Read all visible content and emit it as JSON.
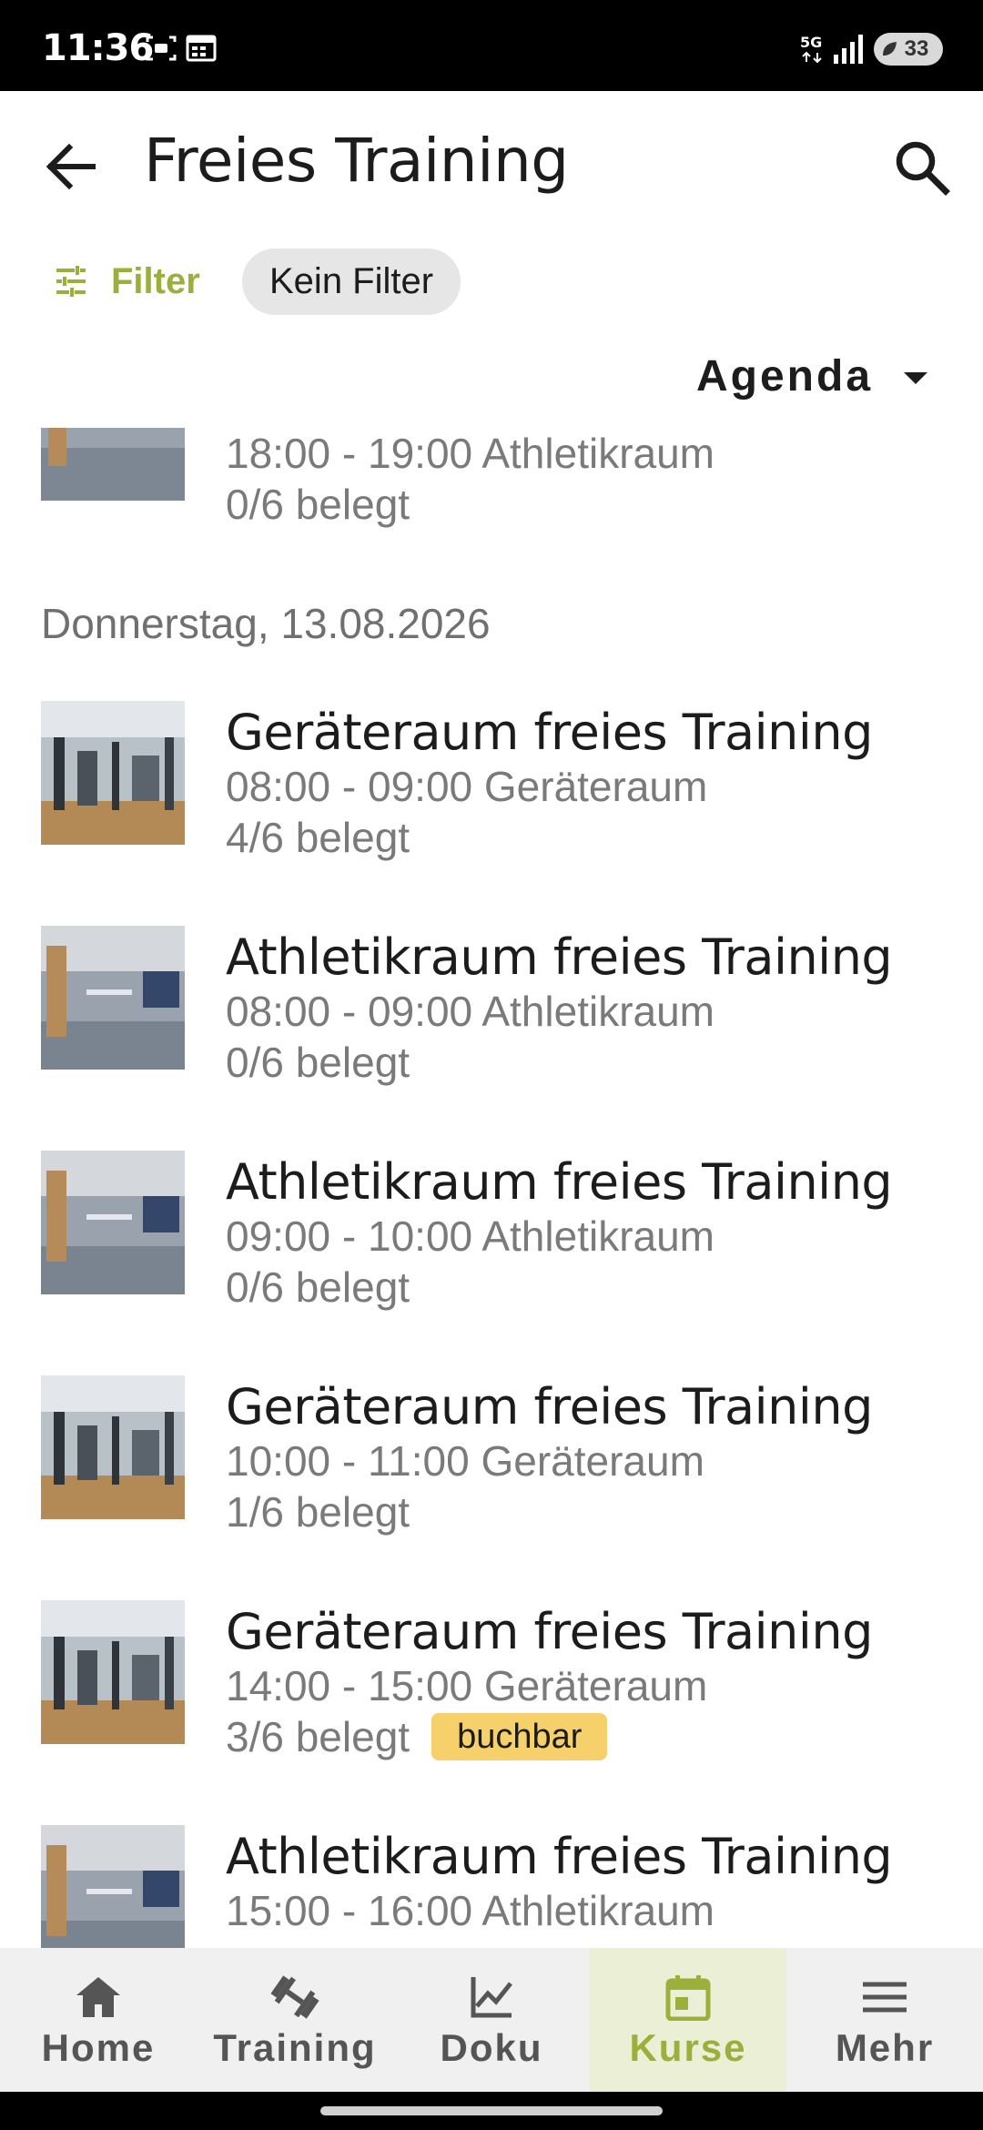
{
  "status_bar": {
    "time": "11:36",
    "network": "5G",
    "battery": "33"
  },
  "app_bar": {
    "title": "Freies Training",
    "back_icon": "arrow-back-icon",
    "search_icon": "search-icon"
  },
  "filter": {
    "label": "Filter",
    "icon": "tune-icon",
    "chip_label": "Kein Filter",
    "accent_color": "#9bb03a"
  },
  "view_mode": {
    "selected": "Agenda"
  },
  "list": {
    "partial_row": {
      "line1": "18:00 - 19:00 Athletikraum",
      "line2": "0/6 belegt",
      "image": "athletikraum"
    },
    "day_header": "Donnerstag, 13.08.2026",
    "rows": [
      {
        "title": "Geräteraum freies Training",
        "line1": "08:00 - 09:00 Geräteraum",
        "line2": "4/6 belegt",
        "badge": "",
        "image": "geraeteraum"
      },
      {
        "title": "Athletikraum freies Training",
        "line1": "08:00 - 09:00 Athletikraum",
        "line2": "0/6 belegt",
        "badge": "",
        "image": "athletikraum"
      },
      {
        "title": "Athletikraum freies Training",
        "line1": "09:00 - 10:00 Athletikraum",
        "line2": "0/6 belegt",
        "badge": "",
        "image": "athletikraum"
      },
      {
        "title": "Geräteraum freies Training",
        "line1": "10:00 - 11:00 Geräteraum",
        "line2": "1/6 belegt",
        "badge": "",
        "image": "geraeteraum"
      },
      {
        "title": "Geräteraum freies Training",
        "line1": "14:00 - 15:00 Geräteraum",
        "line2": "3/6 belegt",
        "badge": "buchbar",
        "image": "geraeteraum"
      },
      {
        "title": "Athletikraum freies Training",
        "line1": "15:00 - 16:00 Athletikraum",
        "line2": "",
        "badge": "",
        "image": "athletikraum"
      }
    ],
    "badge_color": "#f6d06a"
  },
  "bottom_nav": {
    "items": [
      {
        "label": "Home",
        "icon": "home-icon",
        "active": false
      },
      {
        "label": "Training",
        "icon": "dumbbell-icon",
        "active": false
      },
      {
        "label": "Doku",
        "icon": "chart-line-icon",
        "active": false
      },
      {
        "label": "Kurse",
        "icon": "calendar-icon",
        "active": true
      },
      {
        "label": "Mehr",
        "icon": "menu-icon",
        "active": false
      }
    ]
  }
}
